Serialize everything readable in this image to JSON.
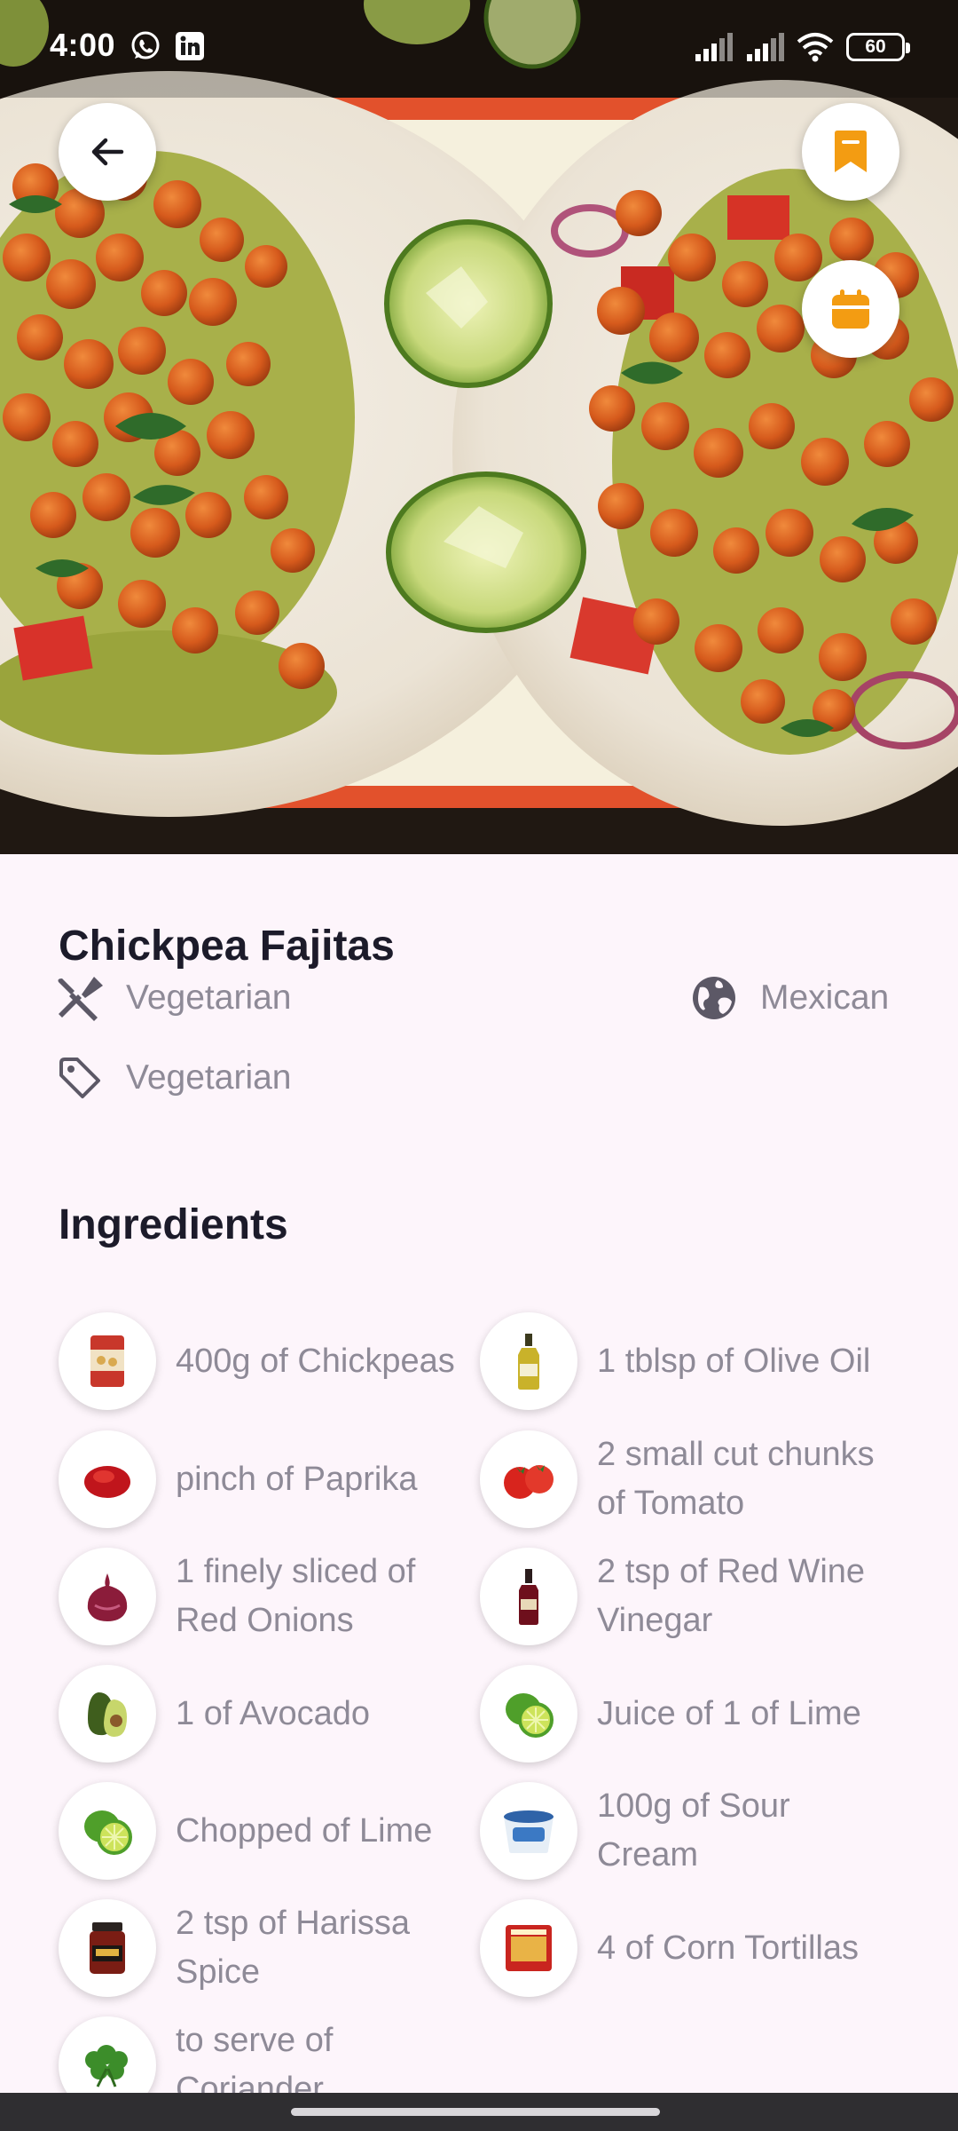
{
  "status_bar": {
    "time": "4:00",
    "battery": "60",
    "app_icons": [
      "whatsapp-icon",
      "linkedin-icon"
    ],
    "system_icons": [
      "signal-icon",
      "signal-icon",
      "wifi-icon",
      "battery-icon"
    ]
  },
  "header": {
    "back_icon": "arrow-left-icon",
    "bookmark_icon": "bookmark-icon",
    "calendar_icon": "calendar-icon"
  },
  "recipe": {
    "title": "Chickpea Fajitas",
    "category": "Vegetarian",
    "cuisine": "Mexican",
    "tag": "Vegetarian"
  },
  "ingredients": {
    "title": "Ingredients",
    "items": [
      {
        "text": "400g of Chickpeas",
        "icon": "chickpeas-can-icon"
      },
      {
        "text": "1 tblsp  of Olive Oil",
        "icon": "olive-oil-bottle-icon"
      },
      {
        "text": "pinch of Paprika",
        "icon": "paprika-icon"
      },
      {
        "text": "2 small cut chunks of Tomato",
        "icon": "tomato-icon"
      },
      {
        "text": "1 finely sliced of Red Onions",
        "icon": "red-onion-icon"
      },
      {
        "text": "2 tsp of Red Wine Vinegar",
        "icon": "vinegar-bottle-icon"
      },
      {
        "text": "1 of Avocado",
        "icon": "avocado-icon"
      },
      {
        "text": "Juice of 1 of Lime",
        "icon": "lime-icon"
      },
      {
        "text": "Chopped of Lime",
        "icon": "lime-icon"
      },
      {
        "text": "100g  of Sour Cream",
        "icon": "sour-cream-icon"
      },
      {
        "text": "2 tsp of Harissa Spice",
        "icon": "harissa-jar-icon"
      },
      {
        "text": "4 of Corn Tortillas",
        "icon": "tortillas-pack-icon"
      },
      {
        "text": "to serve of Coriander",
        "icon": "coriander-icon"
      }
    ]
  },
  "colors": {
    "accent": "#f39c12",
    "background": "#fdf5fb",
    "title": "#1c1b2a",
    "muted": "#8e8a97"
  }
}
